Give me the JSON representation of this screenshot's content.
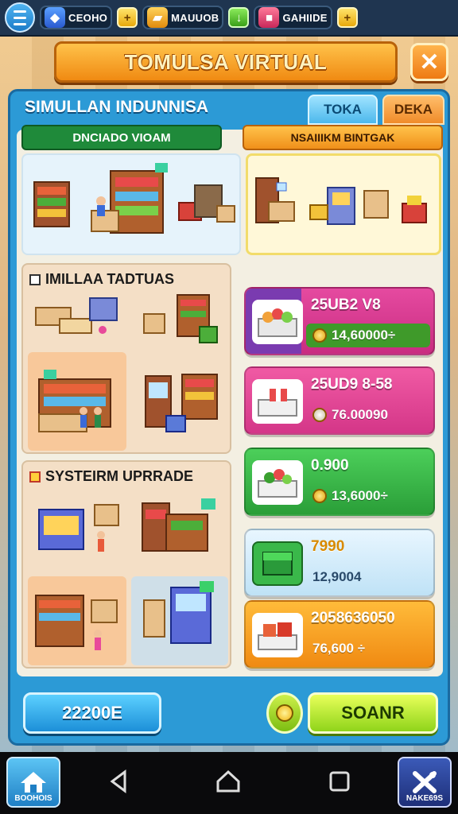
{
  "topbar": {
    "menu_icon": "hamburger-icon",
    "resources": [
      {
        "label": "CEOHO",
        "icon": "shield-gem-icon",
        "color": "#2a6ad8"
      },
      {
        "label": "MAUUOB",
        "icon": "gold-bars-icon",
        "color": "#e8a90c"
      },
      {
        "label": "GAHIIDE",
        "icon": "gift-box-icon",
        "color": "#d83a5a"
      }
    ],
    "plus_symbol": "+"
  },
  "title": "TOMULSA VIRTUAL",
  "close_symbol": "✕",
  "panel": {
    "title": "SIMULLAN INDUNNISA",
    "tabs": [
      {
        "label": "TOKA"
      },
      {
        "label": "DEKA"
      }
    ],
    "subheader_left": "DNCIADO VIOAM",
    "subheader_right": "NSAIIIKM BINTGAK",
    "sections": [
      {
        "title": "IMILLAA TADTUAS"
      },
      {
        "title": "SYSTEIRM UPRRADE"
      }
    ],
    "shop_items": [
      {
        "name": "25UB2 V8",
        "price": "14,60000÷",
        "icon": "fruit-crate-icon"
      },
      {
        "name": "25UD9 8-58",
        "price": "76.00090",
        "icon": "gift-tray-icon"
      },
      {
        "name": "0.900",
        "price": "13,6000÷",
        "icon": "veggie-crate-icon"
      },
      {
        "name": "7990",
        "price": "12,9004",
        "icon": "green-chest-icon"
      },
      {
        "name": "2058636050",
        "price": "76,600 ÷",
        "icon": "sweets-tray-icon"
      }
    ],
    "btn_left": "22200E",
    "btn_right": "SOANR"
  },
  "navbar": {
    "home_label": "BOOHOIS",
    "skill_label": "NAKE69S"
  },
  "colors": {
    "panel_blue": "#2c9ad6",
    "title_orange": "#f08a12",
    "accent_green": "#8fd41a"
  }
}
